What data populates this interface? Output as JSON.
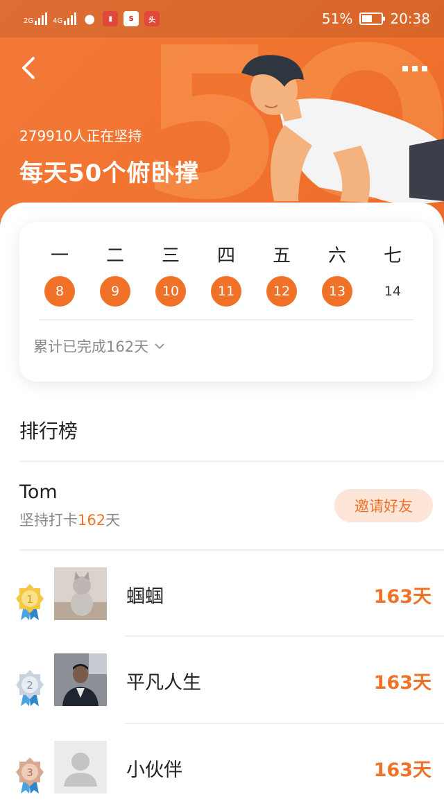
{
  "status_bar": {
    "signal_1": "2G",
    "signal_2": "4G",
    "battery": "51%",
    "time": "20:38",
    "app_icons": [
      "wechat-icon",
      "reader-icon",
      "sina-icon",
      "toutiao-icon"
    ]
  },
  "header": {
    "participants": "279910人正在坚持",
    "title": "每天50个俯卧撑",
    "back_icon": "back-arrow-icon",
    "more_icon": "more-icon"
  },
  "calendar": {
    "weekdays": [
      "一",
      "二",
      "三",
      "四",
      "五",
      "六",
      "七"
    ],
    "dates": [
      {
        "day": "8",
        "done": true
      },
      {
        "day": "9",
        "done": true
      },
      {
        "day": "10",
        "done": true
      },
      {
        "day": "11",
        "done": true
      },
      {
        "day": "12",
        "done": true
      },
      {
        "day": "13",
        "done": true
      },
      {
        "day": "14",
        "done": false
      }
    ],
    "total_text": "累计已完成162天"
  },
  "leaderboard": {
    "title": "排行榜",
    "me": {
      "name": "Tom",
      "days_prefix": "坚持打卡",
      "days_value": "162",
      "days_suffix": "天",
      "invite_label": "邀请好友"
    },
    "entries": [
      {
        "rank": "1",
        "name": "蝈蝈",
        "days": "163天"
      },
      {
        "rank": "2",
        "name": "平凡人生",
        "days": "163天"
      },
      {
        "rank": "3",
        "name": "小伙伴",
        "days": "163天"
      }
    ]
  },
  "colors": {
    "accent": "#f07228",
    "invite_bg": "#fde6d8"
  }
}
